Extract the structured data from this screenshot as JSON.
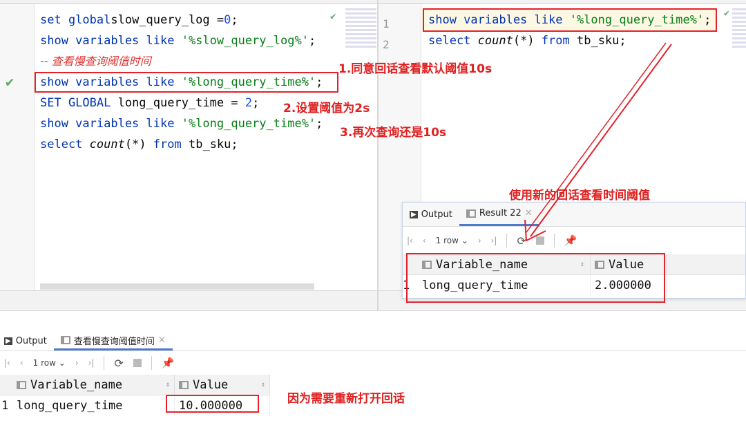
{
  "left_editor": {
    "lines": [
      {
        "parts": [
          [
            "kw",
            "set global"
          ],
          [
            "",
            "slow_query_log ="
          ],
          [
            "num",
            "0"
          ],
          [
            "",
            ";"
          ]
        ]
      },
      {
        "parts": [
          [
            "kw",
            "show variables like "
          ],
          [
            "str",
            "'%slow_query_log%'"
          ],
          [
            "",
            ";"
          ]
        ]
      },
      {
        "parts": [
          [
            "cm",
            "-- 查看慢查询阈值时间"
          ]
        ]
      },
      {
        "parts": [
          [
            "kw",
            "show variables like "
          ],
          [
            "str",
            "'%long_query_time%'"
          ],
          [
            "",
            ";"
          ]
        ]
      },
      {
        "parts": [
          [
            "kw",
            "SET GLOBAL "
          ],
          [
            "",
            "long_query_time = "
          ],
          [
            "num",
            "2"
          ],
          [
            "",
            ";"
          ]
        ]
      },
      {
        "parts": [
          [
            "kw",
            "show variables like "
          ],
          [
            "str",
            "'%long_query_time%'"
          ],
          [
            "",
            ";"
          ]
        ]
      },
      {
        "parts": [
          [
            "kw",
            "select "
          ],
          [
            "fn",
            "count"
          ],
          [
            "",
            "(*) "
          ],
          [
            "kw",
            "from "
          ],
          [
            "",
            "tb_sku;"
          ]
        ]
      }
    ]
  },
  "right_editor": {
    "line_numbers": [
      "1",
      "2"
    ],
    "lines": [
      {
        "parts": [
          [
            "kw",
            "show variables like "
          ],
          [
            "str",
            "'%long_query_time%'"
          ],
          [
            "",
            ";"
          ]
        ]
      },
      {
        "parts": [
          [
            "kw",
            "select "
          ],
          [
            "fn",
            "count"
          ],
          [
            "",
            "(*) "
          ],
          [
            "kw",
            "from "
          ],
          [
            "",
            "tb_sku;"
          ]
        ]
      }
    ]
  },
  "annotations": {
    "a1": "1.同意回话查看默认阈值10s",
    "a2": "2.设置阈值为2s",
    "a3": "3.再次查询还是10s",
    "a4": "使用新的回话查看时间阈值",
    "a5": "因为需要重新打开回话"
  },
  "right_result": {
    "tabs": [
      "Output",
      "Result 22"
    ],
    "rows_label": "1 row",
    "columns": [
      "Variable_name",
      "Value"
    ],
    "rows": [
      [
        "1",
        "long_query_time",
        "2.000000"
      ]
    ]
  },
  "bottom_result": {
    "tabs": [
      "Output",
      "查看慢查询阈值时间"
    ],
    "rows_label": "1 row",
    "columns": [
      "Variable_name",
      "Value"
    ],
    "rows": [
      [
        "1",
        "long_query_time",
        "10.000000"
      ]
    ]
  },
  "colors": {
    "accent": "#4d78cc",
    "annotation": "#e5202a",
    "check": "#59a869"
  }
}
